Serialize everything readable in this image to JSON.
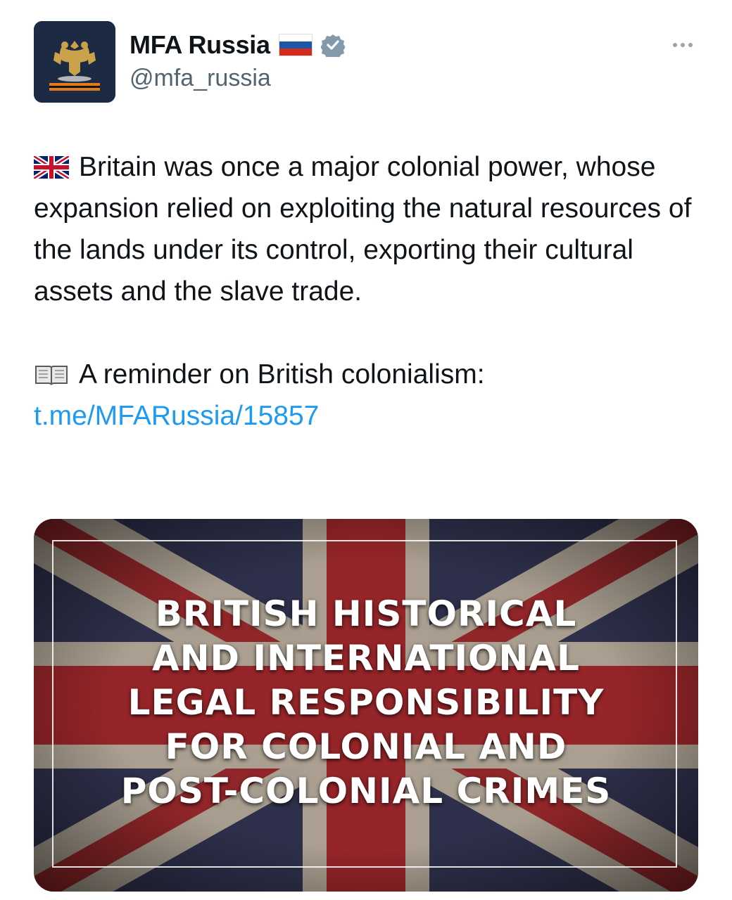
{
  "author": {
    "display_name": "MFA Russia",
    "handle": "@mfa_russia",
    "flag_icon": "russia-flag-icon",
    "verified_icon": "verified-badge-icon",
    "avatar_icon": "coat-of-arms-icon"
  },
  "menu": {
    "more_icon": "more-options-icon"
  },
  "tweet": {
    "paragraph1_icon": "uk-flag-icon",
    "paragraph1": "Britain was once a major colonial power, whose expansion relied on exploiting the natural resources of the lands under its control, exporting their cultural assets and the slave trade.",
    "paragraph2_icon": "open-book-icon",
    "paragraph2_text": "A reminder on British colonialism: ",
    "paragraph2_link": "t.me/MFARussia/15857"
  },
  "media": {
    "headline_lines": [
      "BRITISH HISTORICAL",
      "AND INTERNATIONAL",
      "LEGAL RESPONSIBILITY",
      "FOR COLONIAL AND",
      "POST-COLONIAL CRIMES"
    ]
  },
  "colors": {
    "text": "#0f1419",
    "secondary": "#536471",
    "link": "#1d9bf0",
    "verified": "#829aab",
    "flag_blue": "#26325a",
    "flag_red": "#b0242c"
  }
}
